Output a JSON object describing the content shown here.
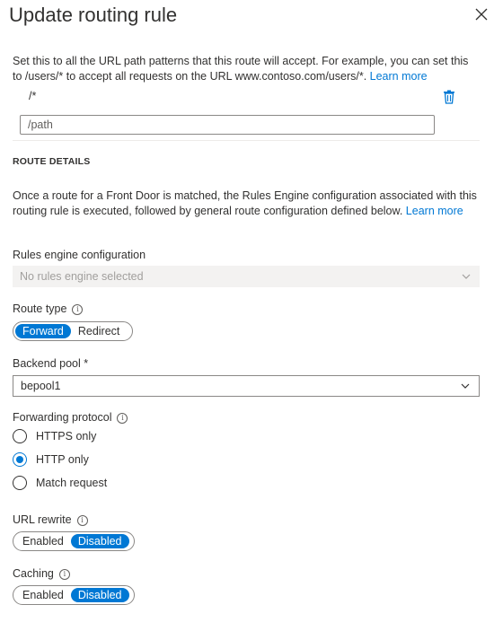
{
  "panel": {
    "title": "Update routing rule"
  },
  "patterns": {
    "description": "Set this to all the URL path patterns that this route will accept. For example, you can set this to /users/* to accept all requests on the URL www.contoso.com/users/*.",
    "learn_more": "Learn more",
    "existing_value": "/*",
    "input_placeholder": "/path"
  },
  "route_details": {
    "heading": "ROUTE DETAILS",
    "description": "Once a route for a Front Door is matched, the Rules Engine configuration associated with this routing rule is executed, followed by general route configuration defined below.",
    "learn_more": "Learn more"
  },
  "rules_engine": {
    "label": "Rules engine configuration",
    "value": "No rules engine selected"
  },
  "route_type": {
    "label": "Route type",
    "options": [
      "Forward",
      "Redirect"
    ],
    "selected": "Forward"
  },
  "backend_pool": {
    "label": "Backend pool *",
    "value": "bepool1"
  },
  "forwarding_protocol": {
    "label": "Forwarding protocol",
    "options": [
      "HTTPS only",
      "HTTP only",
      "Match request"
    ],
    "selected": "HTTP only"
  },
  "url_rewrite": {
    "label": "URL rewrite",
    "options": [
      "Enabled",
      "Disabled"
    ],
    "selected": "Disabled"
  },
  "caching": {
    "label": "Caching",
    "options": [
      "Enabled",
      "Disabled"
    ],
    "selected": "Disabled"
  },
  "colors": {
    "accent": "#0078d4",
    "text": "#323130",
    "disabled_bg": "#f3f2f1",
    "disabled_text": "#a19f9d"
  }
}
